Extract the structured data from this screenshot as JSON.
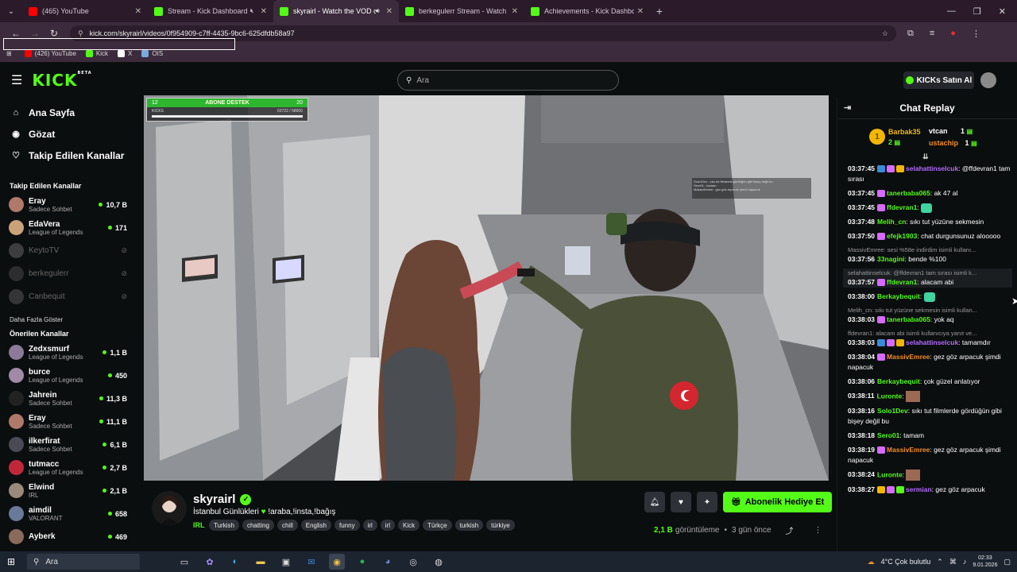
{
  "browser": {
    "tabs": [
      {
        "label": "(465) YouTube",
        "color": "#ff0000",
        "active": false
      },
      {
        "label": "Stream - Kick Dashboard",
        "color": "#53fc18",
        "active": false,
        "muted": true
      },
      {
        "label": "skyrairl - Watch the VOD o",
        "color": "#53fc18",
        "active": true,
        "audio": true
      },
      {
        "label": "berkegulerr Stream - Watch Liv",
        "color": "#53fc18",
        "active": false
      },
      {
        "label": "Achievements - Kick Dashboard",
        "color": "#53fc18",
        "active": false
      }
    ],
    "url": "kick.com/skyrairl/videos/0f954909-c7ff-4435-9bc6-625dfdb58a97",
    "bookmarks": [
      {
        "label": "(426) YouTube",
        "color": "#ff0000"
      },
      {
        "label": "Kick",
        "color": "#53fc18"
      },
      {
        "label": "X",
        "color": "#ffffff"
      },
      {
        "label": "OIS",
        "color": "#7ad"
      }
    ]
  },
  "header": {
    "logo": "KICK",
    "logo_badge": "BETA",
    "search_placeholder": "Ara",
    "kicks_button": "KICKs Satın Al"
  },
  "sidebar": {
    "nav": [
      {
        "label": "Ana Sayfa",
        "icon": "home-icon",
        "glyph": "⌂"
      },
      {
        "label": "Gözat",
        "icon": "browse-icon",
        "glyph": "◉"
      },
      {
        "label": "Takip Edilen Kanallar",
        "icon": "heart-icon",
        "glyph": "♡"
      }
    ],
    "followed_title": "Takip Edilen Kanallar",
    "followed": [
      {
        "name": "Eray",
        "category": "Sadece Sohbet",
        "viewers": "10,7 B",
        "live": true,
        "color": "#b07a6a"
      },
      {
        "name": "EdaVera",
        "category": "League of Legends",
        "viewers": "171",
        "live": true,
        "color": "#c9a27a"
      },
      {
        "name": "KeytoTV",
        "category": "",
        "viewers": "",
        "live": false,
        "color": "#777"
      },
      {
        "name": "berkegulerr",
        "category": "",
        "viewers": "",
        "live": false,
        "color": "#555"
      },
      {
        "name": "Canbequit",
        "category": "",
        "viewers": "",
        "live": false,
        "color": "#666"
      }
    ],
    "show_more": "Daha Fazla Göster",
    "recommended_title": "Önerilen Kanallar",
    "recommended": [
      {
        "name": "Zedxsmurf",
        "category": "League of Legends",
        "viewers": "1,1 B",
        "color": "#8b7a9a"
      },
      {
        "name": "burce",
        "category": "League of Legends",
        "viewers": "450",
        "color": "#a08aa8"
      },
      {
        "name": "Jahrein",
        "category": "Sadece Sohbet",
        "viewers": "11,3 B",
        "color": "#222"
      },
      {
        "name": "Eray",
        "category": "Sadece Sohbet",
        "viewers": "11,1 B",
        "color": "#b07a6a"
      },
      {
        "name": "ilkerfirat",
        "category": "Sadece Sohbet",
        "viewers": "6,1 B",
        "color": "#4a4a55"
      },
      {
        "name": "tutmacc",
        "category": "League of Legends",
        "viewers": "2,7 B",
        "color": "#c0283a"
      },
      {
        "name": "Elwind",
        "category": "IRL",
        "viewers": "2,1 B",
        "color": "#9a8a7a"
      },
      {
        "name": "aimdil",
        "category": "VALORANT",
        "viewers": "658",
        "color": "#6a7a9a"
      },
      {
        "name": "Ayberk",
        "category": "",
        "viewers": "469",
        "color": "#8a6a5a"
      }
    ]
  },
  "video": {
    "overlay_left": "12",
    "overlay_title": "ABONE DESTEK",
    "overlay_right": "20",
    "overlay_sub_left": "KICKS",
    "overlay_sub_right": "63722 / 58000",
    "stream_chat_lines": [
      "Solo1Dev : sıkı tut filmlerde gördüğün gibi bişey değil bu",
      "Sero01 : tamam",
      "MassivEmree : gez göz arpacuk şimdi napacuk"
    ]
  },
  "stream": {
    "name": "skyrairl",
    "title": "İstanbul Günlükleri",
    "title_suffix": " !araba,!insta,!bağış",
    "category": "IRL",
    "tags": [
      "Turkish",
      "chatting",
      "chill",
      "English",
      "funny",
      "irl",
      "irl",
      "Kick",
      "Türkçe",
      "turkish",
      "türkiye"
    ],
    "subscribe_button": "Abonelik Hediye Et",
    "views_value": "2,1 B",
    "views_label": "görüntüleme",
    "ago": "3 gün önce"
  },
  "chat": {
    "title": "Chat Replay",
    "leaderboard": {
      "first_name": "Barbak35",
      "first_count": "2",
      "second_name": "vtcan",
      "second_count": "1",
      "third_name": "ustachip",
      "third_count": "1"
    },
    "messages": [
      {
        "time": "03:37:45",
        "user": "selahattinselcuk",
        "color": "#b36bff",
        "text": "@ffdevran1 tam sırası",
        "reply": "",
        "badges": [
          "#3b8bd9",
          "#d86bff",
          "#f2b705"
        ],
        "emote": false,
        "img": false
      },
      {
        "time": "03:37:45",
        "user": "tanerbaba065",
        "color": "#53fc18",
        "text": "ak 47 al",
        "reply": "",
        "badges": [
          "#d86bff"
        ],
        "emote": false,
        "img": false
      },
      {
        "time": "03:37:45",
        "user": "ffdevran1",
        "color": "#53fc18",
        "text": "",
        "reply": "",
        "badges": [
          "#d86bff"
        ],
        "emote": true,
        "img": false
      },
      {
        "time": "03:37:48",
        "user": "Melih_cn",
        "color": "#53fc18",
        "text": "sıkı tut yüzüne sekmesin",
        "reply": "",
        "badges": [],
        "emote": false,
        "img": false
      },
      {
        "time": "03:37:50",
        "user": "efejk1903",
        "color": "#53fc18",
        "text": "chat durgunsunuz alooooo",
        "reply": "",
        "badges": [
          "#d86bff"
        ],
        "emote": false,
        "img": false
      },
      {
        "time": "03:37:56",
        "user": "33nagini",
        "color": "#53fc18",
        "text": "bende %100",
        "reply": "MassivEmree: sesi %58e indirdim isimli kullanı...",
        "badges": [],
        "emote": false,
        "img": false
      },
      {
        "time": "03:37:57",
        "user": "ffdevran1",
        "color": "#53fc18",
        "text": "alacam abi",
        "reply": "selahattinselcuk: @ffdevran1 tam sırası isimli k...",
        "badges": [
          "#d86bff"
        ],
        "emote": false,
        "img": false,
        "hl": true
      },
      {
        "time": "03:38:00",
        "user": "Berkaybequit",
        "color": "#53fc18",
        "text": "",
        "reply": "",
        "badges": [],
        "emote": true,
        "img": false
      },
      {
        "time": "03:38:03",
        "user": "tanerbaba065",
        "color": "#53fc18",
        "text": "yok aq",
        "reply": "Melih_cn: sıkı tut yüzüne sekmesin isimli kullan...",
        "badges": [
          "#d86bff"
        ],
        "emote": false,
        "img": false
      },
      {
        "time": "03:38:03",
        "user": "selahattinselcuk",
        "color": "#b36bff",
        "text": "tamamdır",
        "reply": "ffdevran1: alacam abi isimli kullanıcıya yanıt ve...",
        "badges": [
          "#3b8bd9",
          "#d86bff",
          "#f2b705"
        ],
        "emote": false,
        "img": false
      },
      {
        "time": "03:38:04",
        "user": "MassivEmree",
        "color": "#f28c28",
        "text": "gez göz arpacuk şimdi napacuk",
        "reply": "",
        "badges": [
          "#d86bff"
        ],
        "emote": false,
        "img": false
      },
      {
        "time": "03:38:06",
        "user": "Berkaybequit",
        "color": "#53fc18",
        "text": "çok güzel anlatıyor",
        "reply": "",
        "badges": [],
        "emote": false,
        "img": false
      },
      {
        "time": "03:38:11",
        "user": "Luronte",
        "color": "#53fc18",
        "text": "",
        "reply": "",
        "badges": [],
        "emote": false,
        "img": true
      },
      {
        "time": "03:38:16",
        "user": "Solo1Dev",
        "color": "#53fc18",
        "text": "sıkı tut filmlerde gördüğün gibi bişey değil bu",
        "reply": "",
        "badges": [],
        "emote": false,
        "img": false
      },
      {
        "time": "03:38:18",
        "user": "Sero01",
        "color": "#53fc18",
        "text": "tamam",
        "reply": "",
        "badges": [],
        "emote": false,
        "img": false
      },
      {
        "time": "03:38:19",
        "user": "MassivEmree",
        "color": "#f28c28",
        "text": "gez göz arpacuk şimdi napacuk",
        "reply": "",
        "badges": [
          "#d86bff"
        ],
        "emote": false,
        "img": false
      },
      {
        "time": "03:38:24",
        "user": "Luronte",
        "color": "#53fc18",
        "text": "",
        "reply": "",
        "badges": [],
        "emote": false,
        "img": true
      },
      {
        "time": "03:38:27",
        "user": "sermian",
        "color": "#b36bff",
        "text": "gez göz arpacuk",
        "reply": "",
        "badges": [
          "#f2b705",
          "#d86bff",
          "#53fc18"
        ],
        "emote": false,
        "img": false
      }
    ]
  },
  "taskbar": {
    "search": "Ara",
    "weather": "4°C  Çok bulutlu",
    "time": "02:33",
    "date": "9.01.2026"
  }
}
